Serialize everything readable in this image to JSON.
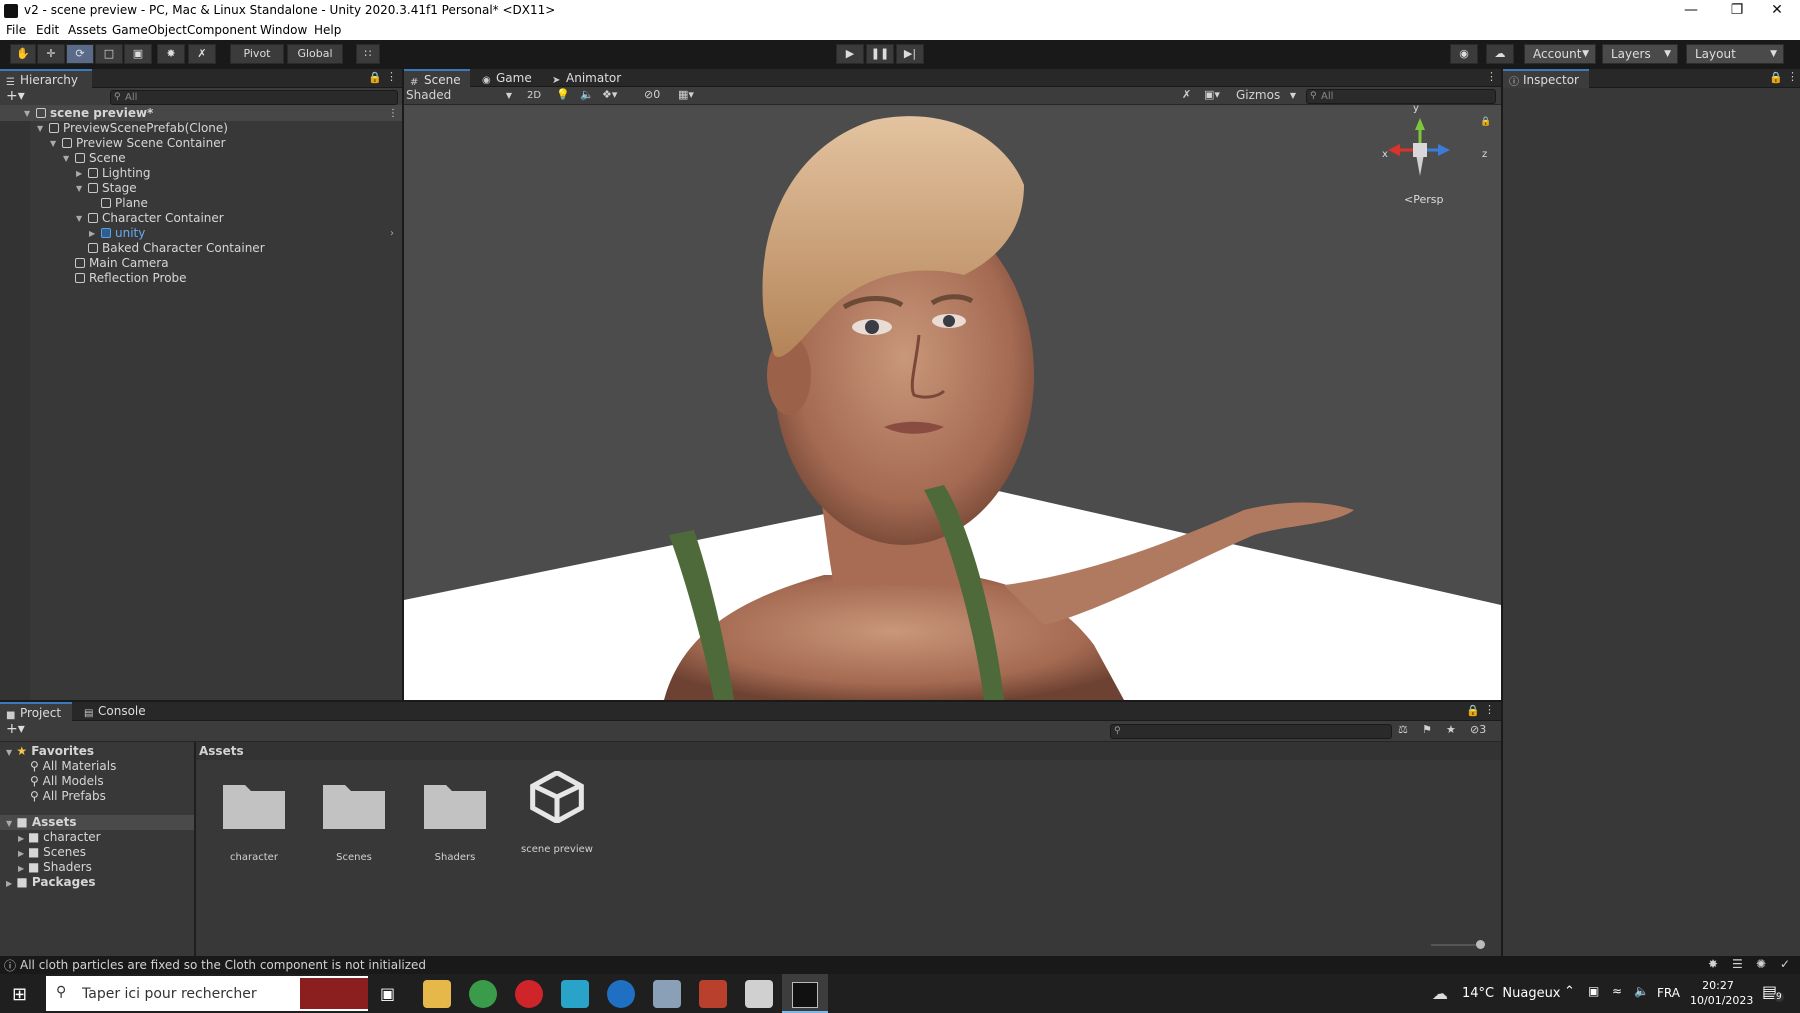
{
  "window": {
    "title": "v2 - scene preview - PC, Mac & Linux Standalone - Unity 2020.3.41f1 Personal* <DX11>"
  },
  "menu": [
    "File",
    "Edit",
    "Assets",
    "GameObject",
    "Component",
    "Window",
    "Help"
  ],
  "toolbar": {
    "pivot": "Pivot",
    "global": "Global",
    "account": "Account",
    "layers": "Layers",
    "layout": "Layout"
  },
  "hierarchy": {
    "tab": "Hierarchy",
    "search_placeholder": "All",
    "items": [
      {
        "label": "scene preview*",
        "depth": 0,
        "expanded": true,
        "type": "scene"
      },
      {
        "label": "PreviewScenePrefab(Clone)",
        "depth": 1,
        "expanded": true,
        "type": "object"
      },
      {
        "label": "Preview Scene Container",
        "depth": 2,
        "expanded": true,
        "type": "object"
      },
      {
        "label": "Scene",
        "depth": 3,
        "expanded": true,
        "type": "object"
      },
      {
        "label": "Lighting",
        "depth": 4,
        "expanded": false,
        "type": "object"
      },
      {
        "label": "Stage",
        "depth": 4,
        "expanded": true,
        "type": "object"
      },
      {
        "label": "Plane",
        "depth": 5,
        "expanded": null,
        "type": "object"
      },
      {
        "label": "Character Container",
        "depth": 4,
        "expanded": true,
        "type": "object"
      },
      {
        "label": "unity",
        "depth": 5,
        "expanded": false,
        "type": "prefab"
      },
      {
        "label": "Baked Character Container",
        "depth": 4,
        "expanded": null,
        "type": "object"
      },
      {
        "label": "Main Camera",
        "depth": 3,
        "expanded": null,
        "type": "object"
      },
      {
        "label": "Reflection Probe",
        "depth": 3,
        "expanded": null,
        "type": "object"
      }
    ]
  },
  "scene": {
    "tabs": [
      "Scene",
      "Game",
      "Animator"
    ],
    "shading": "Shaded",
    "mode_2d": "2D",
    "hidden_count": "0",
    "gizmos": "Gizmos",
    "search_placeholder": "All",
    "axis_x": "x",
    "axis_y": "y",
    "axis_z": "z",
    "projection": "Persp"
  },
  "inspector": {
    "tab": "Inspector"
  },
  "project": {
    "tabs": [
      "Project",
      "Console"
    ],
    "hidden_count": "3",
    "sidebar": {
      "favorites": "Favorites",
      "favorite_items": [
        "All Materials",
        "All Models",
        "All Prefabs"
      ],
      "assets": "Assets",
      "asset_folders": [
        "character",
        "Scenes",
        "Shaders"
      ],
      "packages": "Packages"
    },
    "breadcrumb": "Assets",
    "files": [
      {
        "name": "character",
        "kind": "folder"
      },
      {
        "name": "Scenes",
        "kind": "folder"
      },
      {
        "name": "Shaders",
        "kind": "folder"
      },
      {
        "name": "scene preview",
        "kind": "unity-scene"
      }
    ]
  },
  "status": {
    "message": "All cloth particles are fixed so the Cloth component is not initialized"
  },
  "taskbar": {
    "search_placeholder": "Taper ici pour rechercher",
    "weather": "14°C  Nuageux",
    "language": "FRA",
    "time": "20:27",
    "date": "10/01/2023",
    "notifications": "9"
  },
  "colors": {
    "accent_tab": "#3a79bb",
    "selected_blue": "#5aa0e6",
    "panel_bg": "#383838",
    "scene_bg": "#4c4c4c"
  }
}
